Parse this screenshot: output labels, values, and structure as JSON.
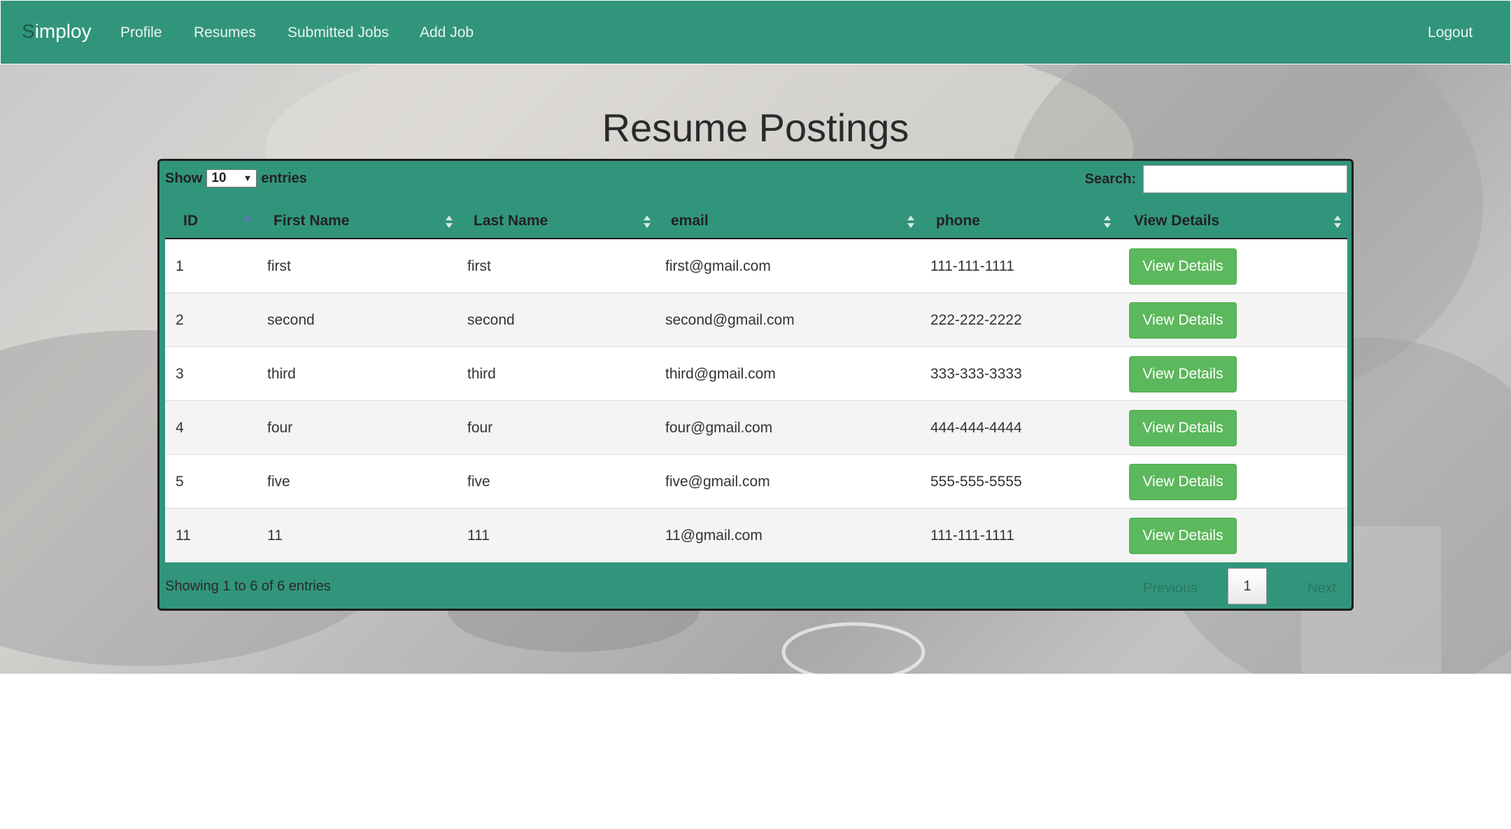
{
  "navbar": {
    "brand_first": "S",
    "brand_rest": "imploy",
    "links": [
      "Profile",
      "Resumes",
      "Submitted Jobs",
      "Add Job"
    ],
    "logout": "Logout"
  },
  "page": {
    "title": "Resume Postings"
  },
  "table_controls": {
    "show_label": "Show",
    "entries_value": "10",
    "entries_label": "entries",
    "search_label": "Search:",
    "search_value": ""
  },
  "table": {
    "columns": [
      "ID",
      "First Name",
      "Last Name",
      "email",
      "phone",
      "View Details"
    ],
    "rows": [
      {
        "id": "1",
        "first": "first",
        "last": "first",
        "email": "first@gmail.com",
        "phone": "111-111-1111",
        "action": "View Details"
      },
      {
        "id": "2",
        "first": "second",
        "last": "second",
        "email": "second@gmail.com",
        "phone": "222-222-2222",
        "action": "View Details"
      },
      {
        "id": "3",
        "first": "third",
        "last": "third",
        "email": "third@gmail.com",
        "phone": "333-333-3333",
        "action": "View Details"
      },
      {
        "id": "4",
        "first": "four",
        "last": "four",
        "email": "four@gmail.com",
        "phone": "444-444-4444",
        "action": "View Details"
      },
      {
        "id": "5",
        "first": "five",
        "last": "five",
        "email": "five@gmail.com",
        "phone": "555-555-5555",
        "action": "View Details"
      },
      {
        "id": "11",
        "first": "11",
        "last": "111",
        "email": "11@gmail.com",
        "phone": "111-111-1111",
        "action": "View Details"
      }
    ]
  },
  "footer": {
    "info": "Showing 1 to 6 of 6 entries",
    "previous": "Previous",
    "current_page": "1",
    "next": "Next"
  },
  "colors": {
    "primary": "#31957c",
    "button": "#5cb85c"
  }
}
